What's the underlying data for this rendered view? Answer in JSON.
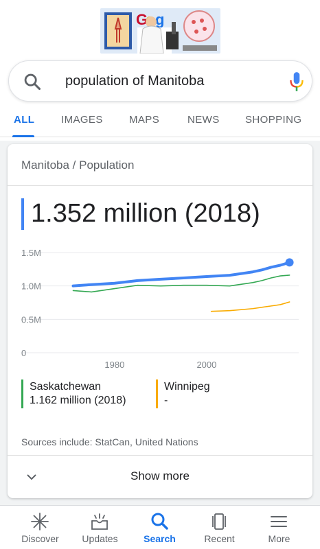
{
  "search": {
    "query": "population of Manitoba"
  },
  "tabs": [
    {
      "label": "ALL",
      "active": true
    },
    {
      "label": "IMAGES",
      "active": false
    },
    {
      "label": "MAPS",
      "active": false
    },
    {
      "label": "NEWS",
      "active": false
    },
    {
      "label": "SHOPPING",
      "active": false
    }
  ],
  "card": {
    "breadcrumb": "Manitoba / Population",
    "answer": "1.352 million (2018)",
    "legend": [
      {
        "name": "Saskatchewan",
        "value": "1.162 million (2018)",
        "color": "#34a853"
      },
      {
        "name": "Winnipeg",
        "value": "-",
        "color": "#f9ab00"
      }
    ],
    "sources": "Sources include: StatCan, United Nations",
    "show_more": "Show more"
  },
  "chart_data": {
    "type": "line",
    "xlabel": "",
    "ylabel": "",
    "x_ticks": [
      "1980",
      "2000"
    ],
    "y_ticks": [
      "0",
      "0.5M",
      "1.0M",
      "1.5M"
    ],
    "xlim": [
      1966,
      2020
    ],
    "ylim": [
      0,
      1.5
    ],
    "grid": true,
    "series": [
      {
        "name": "Manitoba",
        "color": "#4285f4",
        "x": [
          1971,
          1975,
          1980,
          1985,
          1990,
          1995,
          2000,
          2005,
          2010,
          2012,
          2014,
          2016,
          2018
        ],
        "y": [
          1.0,
          1.02,
          1.04,
          1.08,
          1.1,
          1.12,
          1.14,
          1.16,
          1.21,
          1.24,
          1.28,
          1.31,
          1.352
        ]
      },
      {
        "name": "Saskatchewan",
        "color": "#34a853",
        "x": [
          1971,
          1975,
          1980,
          1985,
          1990,
          1995,
          2000,
          2005,
          2010,
          2012,
          2014,
          2016,
          2018
        ],
        "y": [
          0.93,
          0.91,
          0.96,
          1.01,
          1.0,
          1.01,
          1.01,
          1.0,
          1.05,
          1.08,
          1.12,
          1.15,
          1.162
        ]
      },
      {
        "name": "Winnipeg",
        "color": "#f9ab00",
        "x": [
          2001,
          2005,
          2010,
          2014,
          2016,
          2018
        ],
        "y": [
          0.62,
          0.63,
          0.66,
          0.7,
          0.72,
          0.76
        ]
      }
    ]
  },
  "bottom_nav": [
    {
      "label": "Discover",
      "icon": "asterisk-icon",
      "active": false
    },
    {
      "label": "Updates",
      "icon": "updates-icon",
      "active": false
    },
    {
      "label": "Search",
      "icon": "search-icon",
      "active": true
    },
    {
      "label": "Recent",
      "icon": "recent-icon",
      "active": false
    },
    {
      "label": "More",
      "icon": "menu-icon",
      "active": false
    }
  ]
}
